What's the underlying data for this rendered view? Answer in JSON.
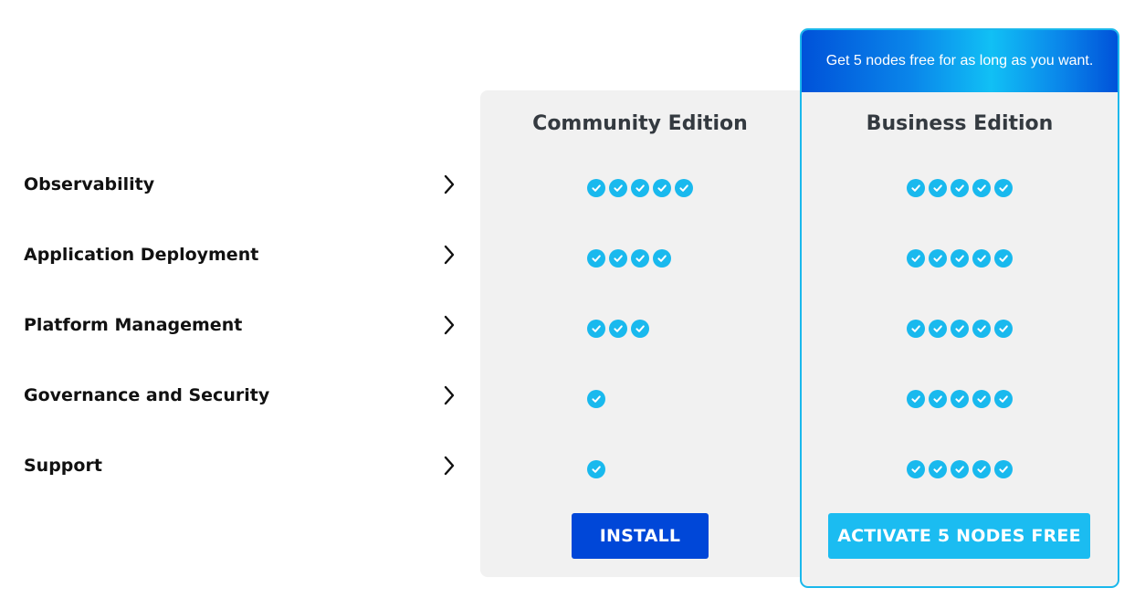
{
  "business_banner": "Get 5 nodes free for as long as you want.",
  "columns": {
    "community": {
      "title": "Community Edition",
      "button_label": "INSTALL"
    },
    "business": {
      "title": "Business Edition",
      "button_label": "ACTIVATE 5 NODES FREE"
    }
  },
  "features": [
    {
      "label": "Observability",
      "community_checks": 5,
      "business_checks": 5
    },
    {
      "label": "Application Deployment",
      "community_checks": 4,
      "business_checks": 5
    },
    {
      "label": "Platform Management",
      "community_checks": 3,
      "business_checks": 5
    },
    {
      "label": "Governance and Security",
      "community_checks": 1,
      "business_checks": 5
    },
    {
      "label": "Support",
      "community_checks": 1,
      "business_checks": 5
    }
  ],
  "colors": {
    "check": "#19b9ee",
    "install_button": "#0047d8",
    "activate_button": "#1bbcf1",
    "panel_bg": "#f1f1f1",
    "business_border": "#1ab8ec"
  },
  "icons": {
    "row_expand": "chevron-right-icon",
    "check": "check-circle-icon"
  }
}
